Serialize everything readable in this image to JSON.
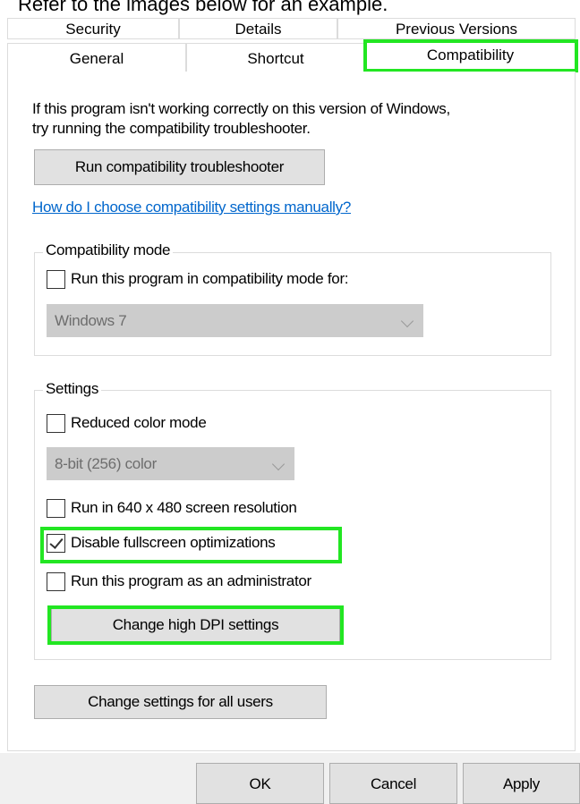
{
  "caption": "Refer to the images below for an example.",
  "tabs_row1": [
    "Security",
    "Details",
    "Previous Versions"
  ],
  "tabs_row2": [
    "General",
    "Shortcut",
    "Compatibility"
  ],
  "intro_text": [
    "If this program isn't working correctly on this version of Windows,",
    "try running the compatibility troubleshooter."
  ],
  "troubleshooter_button": "Run compatibility troubleshooter",
  "manual_link": "How do I choose compatibility settings manually?",
  "compat_mode": {
    "group_label": "Compatibility mode",
    "checkbox_label": "Run this program in compatibility mode for:",
    "checked": false,
    "select_value": "Windows 7"
  },
  "settings": {
    "group_label": "Settings",
    "reduced_color": {
      "label": "Reduced color mode",
      "checked": false
    },
    "color_select_value": "8-bit (256) color",
    "res_640": {
      "label": "Run in 640 x 480 screen resolution",
      "checked": false
    },
    "fullscreen_opt": {
      "label": "Disable fullscreen optimizations",
      "checked": true
    },
    "admin": {
      "label": "Run this program as an administrator",
      "checked": false
    },
    "dpi_button": "Change high DPI settings"
  },
  "all_users_button": "Change settings for all users",
  "footer": {
    "ok": "OK",
    "cancel": "Cancel",
    "apply": "Apply"
  },
  "highlight_color": "#22e622"
}
